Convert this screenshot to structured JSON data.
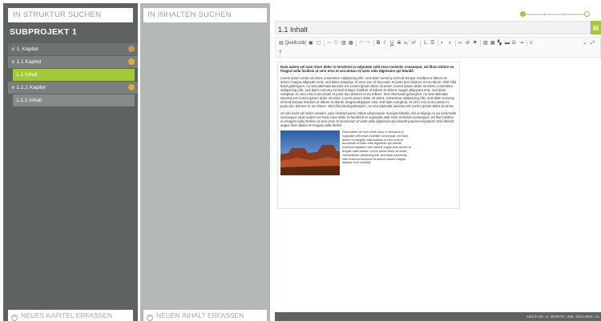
{
  "structure": {
    "search_placeholder": "IN STRUKTUR SUCHEN",
    "project_title": "SUBPROJEKT 1",
    "tree": [
      {
        "label": "∨ 1. Kapitel"
      },
      {
        "label": "∨ 1.1 Kapitel"
      },
      {
        "label": "1.1 Inhalt"
      },
      {
        "label": "∨ 1.1.1 Kapitel"
      },
      {
        "label": "1.1.1 Inhalt"
      }
    ],
    "add_chapter": "NEUES KAPITEL ERFASSEN"
  },
  "content": {
    "search_placeholder": "IN INHALTEN SUCHEN",
    "add_content": "NEUEN INHALT ERFASSEN"
  },
  "editor": {
    "title": "1.1 Inhalt",
    "source_label": "Quellcode",
    "status": "ABSÄTZE: 5, WORTE: 308, ZEICHEN: 15",
    "paragraphs": {
      "p1": "Duis autem vel eum iriure dolor in hendrerit in vulputate velit esse molestie consequat, vel illum dolore eu feugiat nulla facilisis at vero eros et accumsan et iusto odio dignissim qui blandit",
      "p2": "Lorem ipsum dolor sit amet, consetetur sadipscing elitr, sed diam nonumy eirmod tempor invidunt ut labore et dolore magna aliquyam erat, sed diam voluptua. At vero eos et accusam et justo duo dolores et ea rebum. Stet clita kasd gubergren, no sea takimata sanctus est Lorem ipsum dolor sit amet. Lorem ipsum dolor sit amet, consetetur sadipscing elitr, sed diam nonumy eirmod tempor invidunt ut labore et dolore magna aliquyam erat, sed diam voluptua. At vero eos et accusam et justo duo dolores et ea rebum. Stet clita kasd gubergren, no sea takimata sanctus est Lorem ipsum dolor sit amet. Lorem ipsum dolor sit amet, consetetur sadipscing elitr, sed diam nonumy eirmod tempor invidunt ut labore et dolore magna aliquyam erat, sed diam voluptua. At vero eos et accusam et justo duo dolores et ea rebum. Stet clita kasd gubergren, no sea takimata sanctus est Lorem ipsum dolor sit amet.",
      "p3": "Ut wisi enim ad minim veniam, quis nostrud exerci tation ullamcorper suscipit lobortis nisl ut aliquip ex ea commodo consequat. Duis autem vel eum iriure dolor in hendrerit in vulputate velit esse molestie consequat, vel illum dolore eu feugiat nulla facilisis at vero eros et accumsan et iusto odio dignissim qui blandit praesent luptatum zzril delenit augue duis dolore te feugait nulla facilisi.",
      "p4": "Duis autem vel eum iriure dolor in hendrerit in vulputate velit esse molestie consequat, vel illum dolore eu feugiat nulla facilisis at vero eros et accumsan et iusto odio dignissim qui blandit praesent luptatum zzril delenit augue duis dolore te feugait nulla facilisi. Lorem ipsum dolor sit amet, consectetuer adipiscing elit, sed diam nonummy nibh euismod tincidunt ut laoreet dolore magna aliquam erat volutpat."
    }
  },
  "colors": {
    "accent": "#a3c93a",
    "dark_panel": "#5e6263",
    "mid_panel": "#b5b8b8",
    "badge": "#e7a93a"
  }
}
